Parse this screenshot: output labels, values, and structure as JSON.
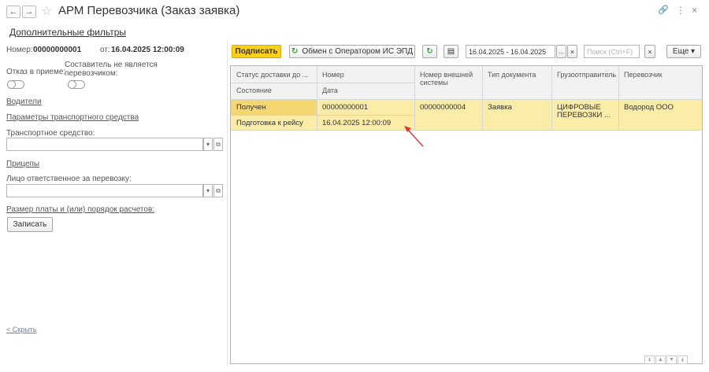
{
  "window": {
    "title": "АРМ Перевозчика (Заказ заявка)",
    "back_icon": "←",
    "forward_icon": "→",
    "star_icon": "☆",
    "link_icon": "🔗",
    "menu_icon": "⋮",
    "close_icon": "×"
  },
  "left": {
    "additional_filters": "Дополнительные фильтры",
    "number_label": "Номер:",
    "number_value": "00000000001",
    "from_label": "от:",
    "from_value": "16.04.2025 12:00:09",
    "refusal_label": "Отказ в приеме:",
    "composer_label": "Составитель не является перевозчиком:",
    "drivers_link": "Водители",
    "vehicle_params_link": "Параметры транспортного средства",
    "vehicle_label": "Транспортное средство:",
    "trailers_link": "Прицепы",
    "responsible_label": "Лицо ответственное за перевозку:",
    "payment_link": "Размер платы и (или) порядок расчетов:",
    "write_button": "Записать",
    "hide_link": "< Скрыть",
    "dropdown_icon": "▾",
    "open_icon": "⧉"
  },
  "toolbar": {
    "sign_button": "Подписать",
    "exchange_button": "Обмен с Оператором ИС ЭПД",
    "refresh_icon": "↻",
    "doc_icon": "▤",
    "period_value": "16.04.2025 - 16.04.2025",
    "period_more": "...",
    "clear_icon": "×",
    "search_placeholder": "Поиск (Ctrl+F)",
    "more_button": "Еще ▾"
  },
  "table": {
    "headers": {
      "status": "Статус доставки до ...",
      "number": "Номер",
      "ext_number": "Номер внешней системы",
      "doc_type": "Тип документа",
      "shipper": "Грузоотправитель",
      "carrier": "Перевозчик",
      "state": "Состояние",
      "date": "Дата"
    },
    "row": {
      "status": "Получен",
      "state": "Подготовка к рейсу",
      "number": "00000000001",
      "date": "16.04.2025 12:00:09",
      "ext_number": "00000000004",
      "doc_type": "Заявка",
      "shipper": "ЦИФРОВЫЕ ПЕРЕВОЗКИ ...",
      "carrier": "Водород ООО"
    },
    "scroll": [
      "⇞",
      "▲",
      "▼",
      "⇟"
    ]
  },
  "colors": {
    "accent_button": "#fcd11e",
    "selected_row": "#fbeca8",
    "link": "#1f4ea1",
    "annotation_arrow": "#d9363e"
  }
}
